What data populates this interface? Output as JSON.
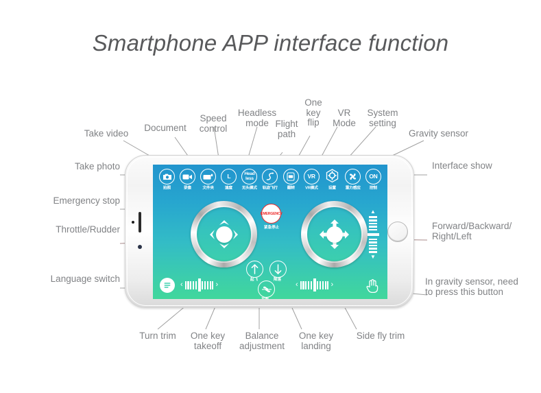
{
  "page": {
    "title": "Smartphone APP interface function",
    "background": "#ffffff",
    "label_color": "#808285"
  },
  "screen": {
    "gradient_top": "#2194cd",
    "gradient_bottom": "#41d79c"
  },
  "toolbar": {
    "icons": [
      {
        "name": "take-photo",
        "glyph": "camera-icon",
        "cn": "拍照"
      },
      {
        "name": "take-video",
        "glyph": "video-icon",
        "cn": "录像"
      },
      {
        "name": "document",
        "glyph": "folder-icon",
        "cn": "文件夹"
      },
      {
        "name": "speed-control",
        "glyph": "L",
        "cn": "速度"
      },
      {
        "name": "headless-mode",
        "glyph": "Head less",
        "cn": "无头模式"
      },
      {
        "name": "flight-path",
        "glyph": "path-icon",
        "cn": "轨迹飞行"
      },
      {
        "name": "one-key-flip",
        "glyph": "flip-icon",
        "cn": "翻转"
      },
      {
        "name": "vr-mode",
        "glyph": "VR",
        "cn": "VR模式"
      },
      {
        "name": "system-setting",
        "glyph": "gear-icon",
        "cn": "设置"
      },
      {
        "name": "gravity-sensor",
        "glyph": "gravity-icon",
        "cn": "重力感应"
      },
      {
        "name": "interface-show",
        "glyph": "ON",
        "cn": "控制"
      }
    ]
  },
  "controls": {
    "emergency_stop": {
      "text": "EMERGENCY",
      "cn": "紧急停止",
      "color": "#ee2b2b"
    },
    "one_key_takeoff": {
      "cn": "起飞"
    },
    "one_key_landing": {
      "cn": "降落"
    },
    "balance_adjustment": {
      "cn": "平衡"
    }
  },
  "callouts": {
    "top": [
      {
        "name": "take-video",
        "text": "Take video"
      },
      {
        "name": "document",
        "text": "Document"
      },
      {
        "name": "speed-control",
        "text": "Speed\ncontrol"
      },
      {
        "name": "headless-mode",
        "text": "Headless\nmode"
      },
      {
        "name": "flight-path",
        "text": "Flight\npath"
      },
      {
        "name": "one-key-flip",
        "text": "One\nkey\nflip"
      },
      {
        "name": "vr-mode",
        "text": "VR\nMode"
      },
      {
        "name": "system-setting",
        "text": "System\nsetting"
      },
      {
        "name": "gravity-sensor",
        "text": "Gravity sensor"
      }
    ],
    "left": [
      {
        "name": "take-photo",
        "text": "Take photo"
      },
      {
        "name": "emergency-stop",
        "text": "Emergency stop"
      },
      {
        "name": "throttle-rudder",
        "text": "Throttle/Rudder"
      },
      {
        "name": "language-switch",
        "text": "Language switch"
      }
    ],
    "right": [
      {
        "name": "interface-show",
        "text": "Interface show"
      },
      {
        "name": "forward-backward-right-left",
        "text": "Forward/Backward/\nRight/Left"
      },
      {
        "name": "gravity-press-button",
        "text": "In gravity sensor, need\nto press this button"
      }
    ],
    "bottom": [
      {
        "name": "turn-trim",
        "text": "Turn trim"
      },
      {
        "name": "one-key-takeoff",
        "text": "One key\ntakeoff"
      },
      {
        "name": "balance-adjustment",
        "text": "Balance\nadjustment"
      },
      {
        "name": "one-key-landing",
        "text": "One key\nlanding"
      },
      {
        "name": "side-fly-trim",
        "text": "Side fly trim"
      }
    ]
  }
}
